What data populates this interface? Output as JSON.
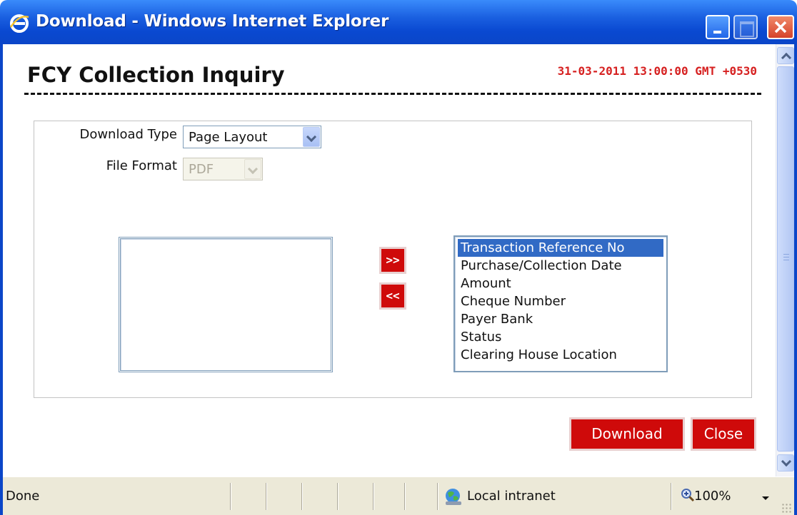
{
  "window": {
    "title": "Download - Windows Internet Explorer"
  },
  "header": {
    "title": "FCY Collection Inquiry",
    "timestamp": "31-03-2011 13:00:00 GMT +0530"
  },
  "form": {
    "download_type_label": "Download Type",
    "download_type_value": "Page Layout",
    "file_format_label": "File Format",
    "file_format_value": "PDF"
  },
  "columns": {
    "available": [],
    "selected": [
      "Transaction Reference No",
      "Purchase/Collection Date",
      "Amount",
      "Cheque Number",
      "Payer Bank",
      "Status",
      "Clearing House Location"
    ],
    "selected_highlight_index": 0,
    "move_right_label": ">>",
    "move_left_label": "<<"
  },
  "actions": {
    "download_label": "Download",
    "close_label": "Close"
  },
  "statusbar": {
    "status": "Done",
    "zone": "Local intranet",
    "zoom": "100%"
  },
  "colors": {
    "accent_red": "#cf0a0a",
    "timestamp_red": "#d62020",
    "titlebar_blue": "#0b46c8",
    "selection_blue": "#316ac5"
  },
  "icons": {
    "title": "internet-explorer-icon",
    "zone": "local-intranet-globe-icon",
    "zoom": "zoom-magnifier-icon"
  }
}
